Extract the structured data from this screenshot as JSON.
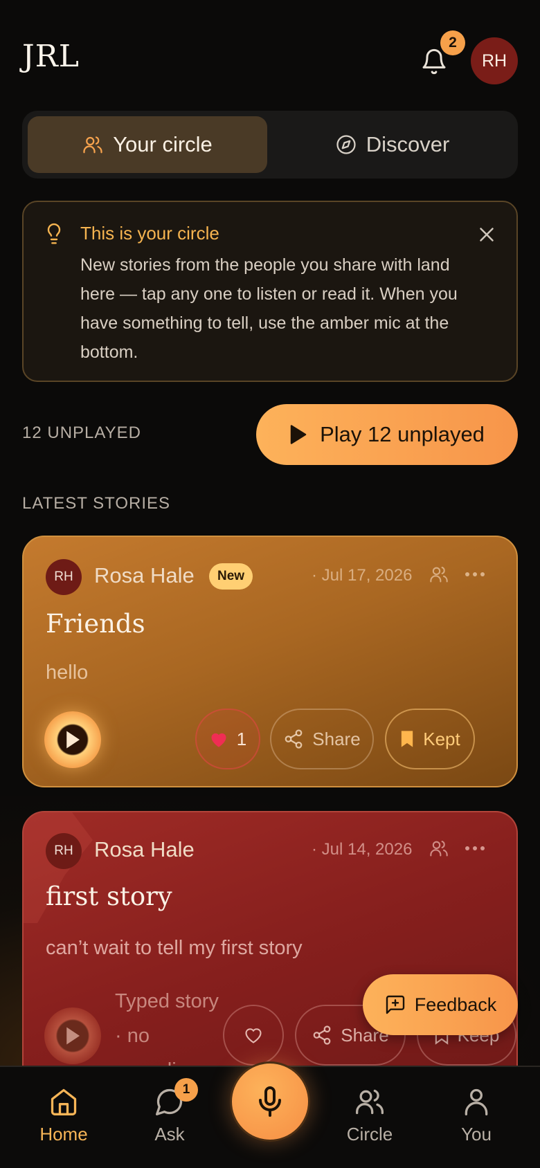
{
  "header": {
    "logo": "JRL",
    "notification_count": "2",
    "avatar_initials": "RH"
  },
  "tabs": [
    {
      "label": "Your circle",
      "icon": "people-icon",
      "active": true
    },
    {
      "label": "Discover",
      "icon": "compass-icon",
      "active": false
    }
  ],
  "tip": {
    "title": "This is your circle",
    "body": "New stories from the people you share with land here — tap any one to listen or read it. When you have something to tell, use the amber mic at the bottom."
  },
  "unplayed": {
    "label": "12 UNPLAYED",
    "button": "Play 12 unplayed"
  },
  "latest_label": "LATEST STORIES",
  "stories": [
    {
      "initials": "RH",
      "author": "Rosa Hale",
      "badge": "New",
      "date": "· Jul 17, 2026",
      "title": "Friends",
      "text": "hello",
      "like_count": "1",
      "share_label": "Share",
      "keep_label": "Kept",
      "liked": true,
      "kept": true
    },
    {
      "initials": "RH",
      "author": "Rosa Hale",
      "date": "· Jul 14, 2026",
      "title": "first story",
      "text": "can’t wait to tell my first story",
      "note": "Typed story · no recording",
      "share_label": "Share",
      "keep_label": "Keep",
      "liked": false,
      "kept": false
    }
  ],
  "feedback_label": "Feedback",
  "nav": {
    "items": [
      {
        "label": "Home",
        "icon": "home-icon",
        "active": true
      },
      {
        "label": "Ask",
        "icon": "chat-icon",
        "badge": "1"
      },
      {
        "label": "Circle",
        "icon": "people-icon"
      },
      {
        "label": "You",
        "icon": "user-icon"
      }
    ],
    "mic_icon": "mic-icon"
  },
  "colors": {
    "accent": "#f7a34e",
    "background": "#0b0a09",
    "card_amber": "#b06c25",
    "card_red": "#8e2421"
  }
}
